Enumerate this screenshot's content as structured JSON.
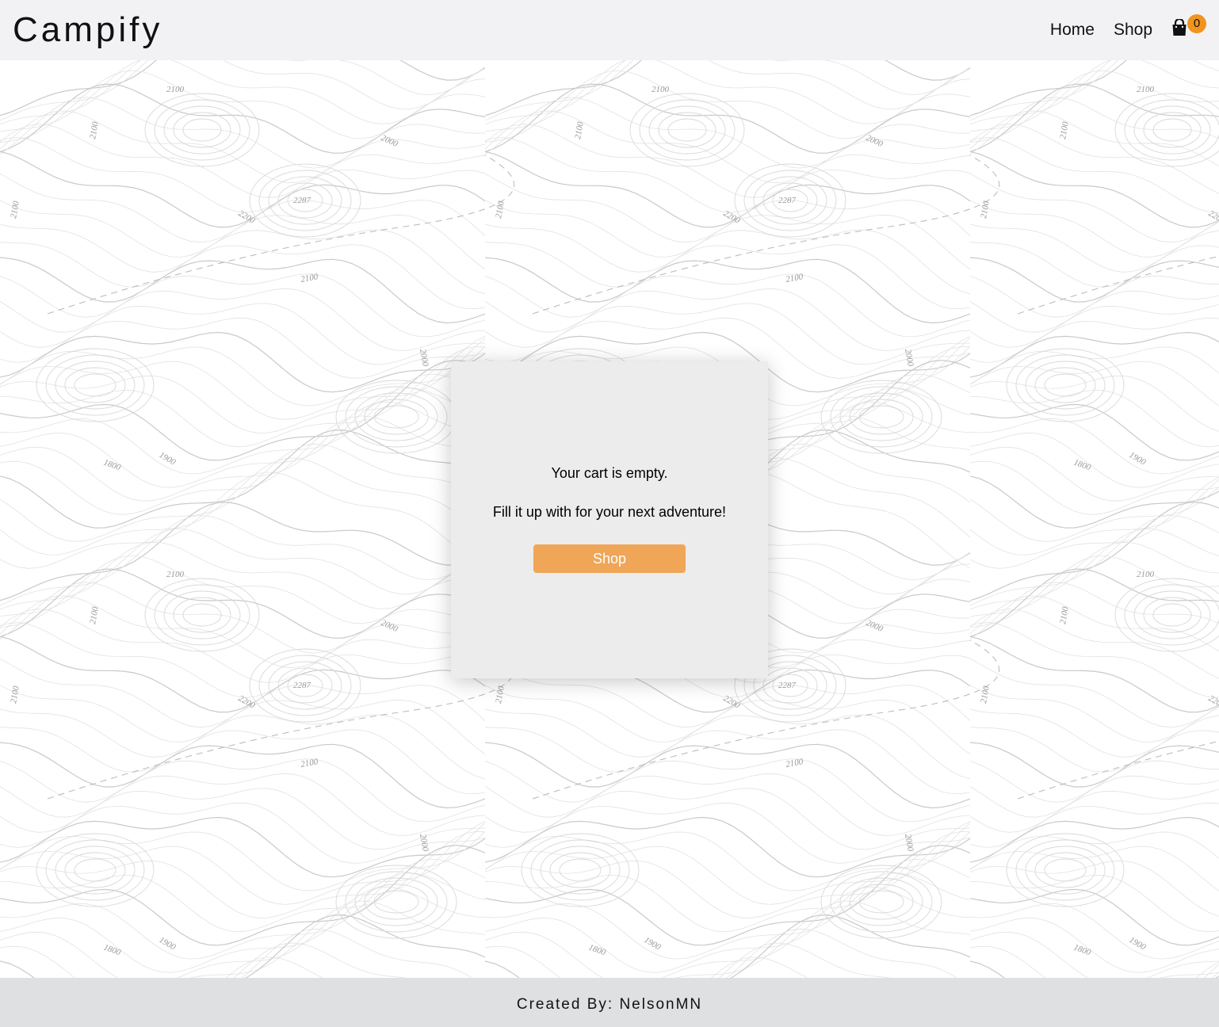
{
  "header": {
    "logo": "Campify",
    "nav": {
      "home": "Home",
      "shop": "Shop"
    },
    "cart": {
      "icon": "shopping-bag-icon",
      "count": "0",
      "badge_color": "#f0941e"
    }
  },
  "main": {
    "background": "topographic-map-pattern",
    "empty_cart": {
      "message": "Your cart is empty.",
      "prompt": "Fill it up with for your next adventure!",
      "button_label": "Shop",
      "button_color": "#f0a657"
    },
    "map_labels": [
      "2000",
      "2100",
      "2200",
      "2287",
      "1900",
      "1800"
    ]
  },
  "footer": {
    "credit": "Created By: NelsonMN"
  }
}
